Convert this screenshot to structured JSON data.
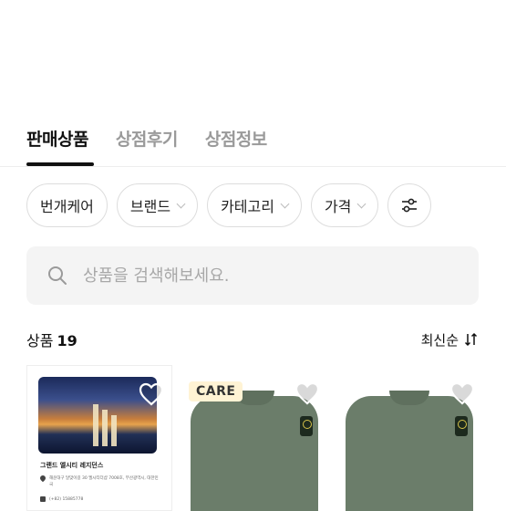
{
  "tabs": [
    {
      "label": "판매상품",
      "active": true
    },
    {
      "label": "상점후기",
      "active": false
    },
    {
      "label": "상점정보",
      "active": false
    }
  ],
  "filters": [
    {
      "label": "번개케어",
      "has_dropdown": false
    },
    {
      "label": "브랜드",
      "has_dropdown": true
    },
    {
      "label": "카테고리",
      "has_dropdown": true
    },
    {
      "label": "가격",
      "has_dropdown": true
    }
  ],
  "filter_settings_icon": "sliders-icon",
  "search": {
    "placeholder": "상품을 검색해보세요.",
    "value": ""
  },
  "count": {
    "label": "상품",
    "value": "19"
  },
  "sort": {
    "label": "최신순",
    "icon": "sort-arrows-icon"
  },
  "products": [
    {
      "type": "ad",
      "title": "그랜드 엘시티 레지던스",
      "address": "해운대구 달맞이길 30 엘시티더샵 7008호, 부산광역시, 대한민국",
      "phone": "(+82) 15885778",
      "favorite_icon": "heart-icon"
    },
    {
      "type": "sweater",
      "badge": "CARE",
      "favorite_icon": "heart-icon"
    },
    {
      "type": "sweater",
      "badge": "",
      "favorite_icon": "heart-icon"
    }
  ],
  "colors": {
    "accent": "#111111",
    "inactive_tab": "#9a9a9a",
    "search_bg": "#f4f4f4",
    "care_badge_bg": "#fff3d4",
    "sweater": "#6b7d6a"
  }
}
